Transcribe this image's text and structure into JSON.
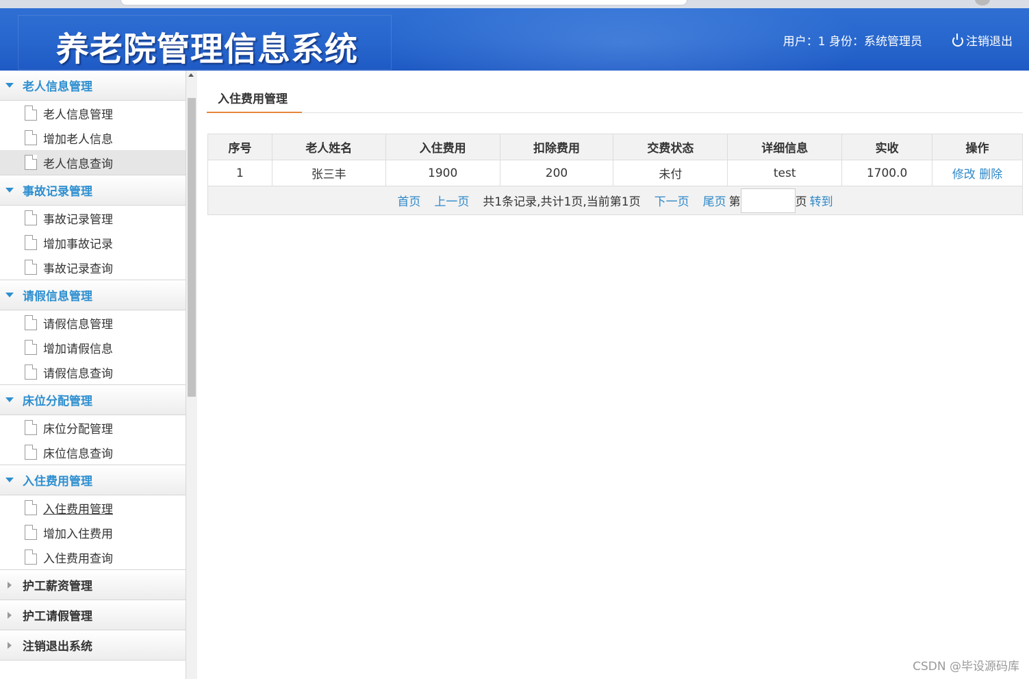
{
  "header": {
    "title": "养老院管理信息系统",
    "user_info": "用户：1 身份：系统管理员",
    "logout_label": "注销退出"
  },
  "sidebar": {
    "groups": [
      {
        "label": "老人信息管理",
        "expanded": true,
        "items": [
          {
            "label": "老人信息管理"
          },
          {
            "label": "增加老人信息"
          },
          {
            "label": "老人信息查询",
            "active": true
          }
        ]
      },
      {
        "label": "事故记录管理",
        "expanded": true,
        "items": [
          {
            "label": "事故记录管理"
          },
          {
            "label": "增加事故记录"
          },
          {
            "label": "事故记录查询"
          }
        ]
      },
      {
        "label": "请假信息管理",
        "expanded": true,
        "items": [
          {
            "label": "请假信息管理"
          },
          {
            "label": "增加请假信息"
          },
          {
            "label": "请假信息查询"
          }
        ]
      },
      {
        "label": "床位分配管理",
        "expanded": true,
        "items": [
          {
            "label": "床位分配管理"
          },
          {
            "label": "床位信息查询"
          }
        ]
      },
      {
        "label": "入住费用管理",
        "expanded": true,
        "items": [
          {
            "label": "入住费用管理",
            "hovered": true
          },
          {
            "label": "增加入住费用"
          },
          {
            "label": "入住费用查询"
          }
        ]
      },
      {
        "label": "护工薪资管理",
        "expanded": false
      },
      {
        "label": "护工请假管理",
        "expanded": false
      },
      {
        "label": "注销退出系统",
        "expanded": false
      }
    ]
  },
  "main": {
    "tab_label": "入住费用管理",
    "table": {
      "columns": [
        "序号",
        "老人姓名",
        "入住费用",
        "扣除费用",
        "交费状态",
        "详细信息",
        "实收",
        "操作"
      ],
      "rows": [
        {
          "index": "1",
          "name": "张三丰",
          "fee": "1900",
          "deduction": "200",
          "status": "未付",
          "detail": "test",
          "received": "1700.0",
          "edit": "修改",
          "delete": "删除"
        }
      ]
    },
    "pager": {
      "first": "首页",
      "prev": "上一页",
      "summary": "共1条记录,共计1页,当前第1页",
      "next": "下一页",
      "last": "尾页",
      "page_prefix": "第",
      "page_input_value": "",
      "page_suffix": "页",
      "go": "转到"
    }
  },
  "watermark": "CSDN @毕设源码库",
  "colors": {
    "accent": "#2e8fd0",
    "header_blue": "#2766cd",
    "tab_underline": "#e8863a",
    "link": "#2e88c8"
  }
}
